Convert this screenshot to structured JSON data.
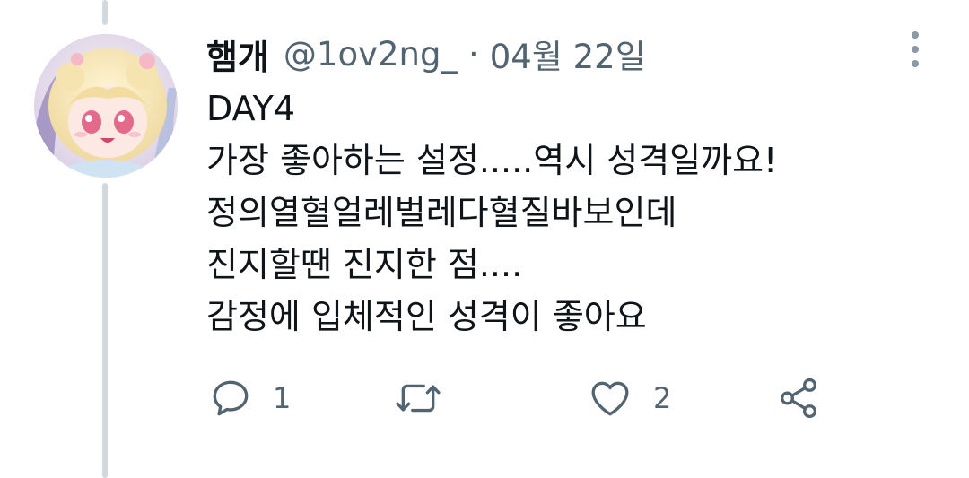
{
  "tweet": {
    "display_name": "햄개",
    "handle": "@1ov2ng_",
    "separator": "·",
    "timestamp": "04월 22일",
    "lines": [
      "DAY4",
      "가장 좋아하는 설정.....역시 성격일까요!",
      "정의열혈얼레벌레다혈질바보인데",
      "진지할땐 진지한 점....",
      "감정에 입체적인 성격이 좋아요"
    ]
  },
  "actions": {
    "reply_count": "1",
    "retweet_count": "",
    "like_count": "2"
  },
  "icons": {
    "reply": "reply-icon",
    "retweet": "retweet-icon",
    "like": "like-icon",
    "share": "share-icon",
    "more": "more-icon"
  },
  "colors": {
    "text_primary": "#0f1419",
    "text_secondary": "#536471",
    "thread_line": "#cfd9de"
  }
}
